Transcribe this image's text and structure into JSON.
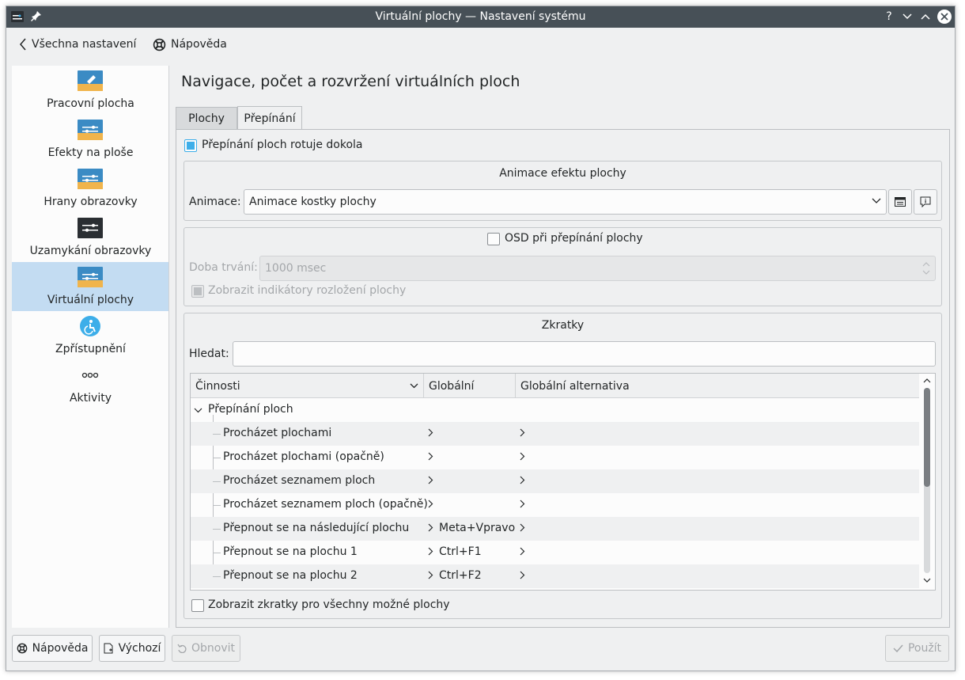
{
  "window": {
    "title": "Virtuální plochy — Nastavení systému"
  },
  "toolbar": {
    "back_label": "Všechna nastavení",
    "help_label": "Nápověda"
  },
  "sidebar": {
    "items": [
      {
        "label": "Pracovní plocha",
        "icon": "desktop-settings-icon"
      },
      {
        "label": "Efekty na ploše",
        "icon": "desktop-effects-icon"
      },
      {
        "label": "Hrany obrazovky",
        "icon": "screen-edges-icon"
      },
      {
        "label": "Uzamykání obrazovky",
        "icon": "screen-lock-icon"
      },
      {
        "label": "Virtuální plochy",
        "icon": "virtual-desktops-icon",
        "active": true
      },
      {
        "label": "Zpřístupnění",
        "icon": "accessibility-icon"
      },
      {
        "label": "Aktivity",
        "icon": "activities-icon"
      }
    ]
  },
  "main": {
    "title": "Navigace, počet a rozvržení virtuálních ploch",
    "tabs": [
      {
        "label": "Plochy",
        "active": false
      },
      {
        "label": "Přepínání",
        "active": true
      }
    ],
    "wrap_checkbox": {
      "label": "Přepínání ploch rotuje dokola",
      "checked": true
    },
    "animation_group": {
      "title": "Animace efektu plochy",
      "animation_label": "Animace:",
      "animation_value": "Animace kostky plochy"
    },
    "osd_group": {
      "osd_label": "OSD při přepínání plochy",
      "osd_checked": false,
      "duration_label": "Doba trvání:",
      "duration_value": "1000 msec",
      "layout_indicators_label": "Zobrazit indikátory rozložení plochy",
      "layout_indicators_checked": true
    },
    "shortcuts_group": {
      "title": "Zkratky",
      "search_label": "Hledat:",
      "search_value": "",
      "columns": [
        "Činnosti",
        "Globální",
        "Globální alternativa"
      ],
      "parent": "Přepínání ploch",
      "rows": [
        {
          "action": "Procházet plochami",
          "global": "",
          "alt": ""
        },
        {
          "action": "Procházet plochami (opačně)",
          "global": "",
          "alt": ""
        },
        {
          "action": "Procházet seznamem ploch",
          "global": "",
          "alt": ""
        },
        {
          "action": "Procházet seznamem ploch (opačně)",
          "global": "",
          "alt": ""
        },
        {
          "action": "Přepnout se na následující plochu",
          "global": "Meta+Vpravo",
          "alt": ""
        },
        {
          "action": "Přepnout se na plochu 1",
          "global": "Ctrl+F1",
          "alt": ""
        },
        {
          "action": "Přepnout se na plochu 2",
          "global": "Ctrl+F2",
          "alt": ""
        }
      ],
      "show_all_label": "Zobrazit zkratky pro všechny možné plochy",
      "show_all_checked": false
    }
  },
  "footer": {
    "help_label": "Nápověda",
    "defaults_label": "Výchozí",
    "reset_label": "Obnovit",
    "apply_label": "Použít"
  },
  "colors": {
    "accent": "#3daee9",
    "titlebar": "#475057",
    "selection": "#c3dcf2"
  }
}
